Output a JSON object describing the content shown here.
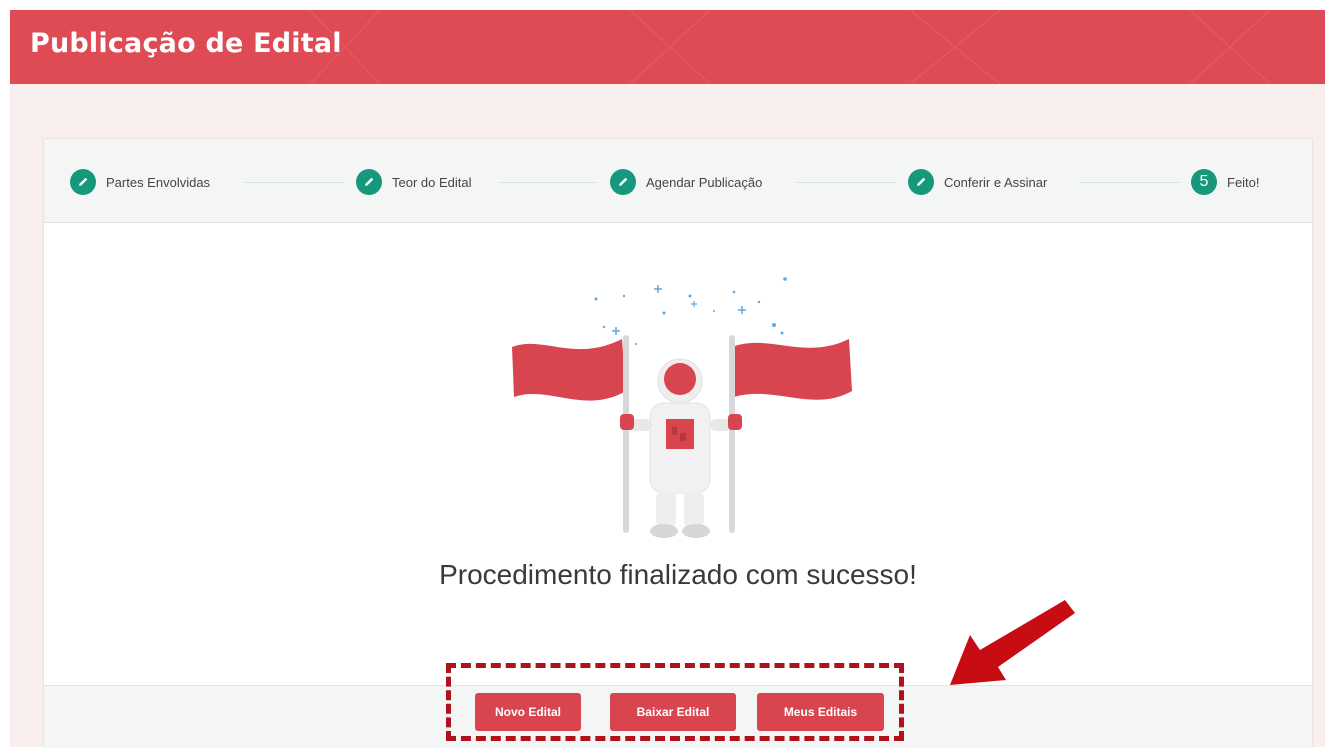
{
  "header": {
    "title": "Publicação de Edital"
  },
  "stepper": {
    "steps": [
      {
        "label": "Partes Envolvidas",
        "icon": "pencil-icon",
        "status": "done"
      },
      {
        "label": "Teor do Edital",
        "icon": "pencil-icon",
        "status": "done"
      },
      {
        "label": "Agendar Publicação",
        "icon": "pencil-icon",
        "status": "done"
      },
      {
        "label": "Conferir e Assinar",
        "icon": "pencil-icon",
        "status": "done"
      },
      {
        "label": "Feito!",
        "number": "5",
        "status": "current"
      }
    ]
  },
  "main": {
    "illustration": "astronaut-with-flags",
    "message": "Procedimento finalizado com sucesso!"
  },
  "actions": {
    "new_label": "Novo Edital",
    "download_label": "Baixar Edital",
    "my_label": "Meus Editais"
  },
  "colors": {
    "header": "#de4b54",
    "step_done": "#16987d",
    "button": "#d9454f",
    "annotation": "#b0121b"
  }
}
